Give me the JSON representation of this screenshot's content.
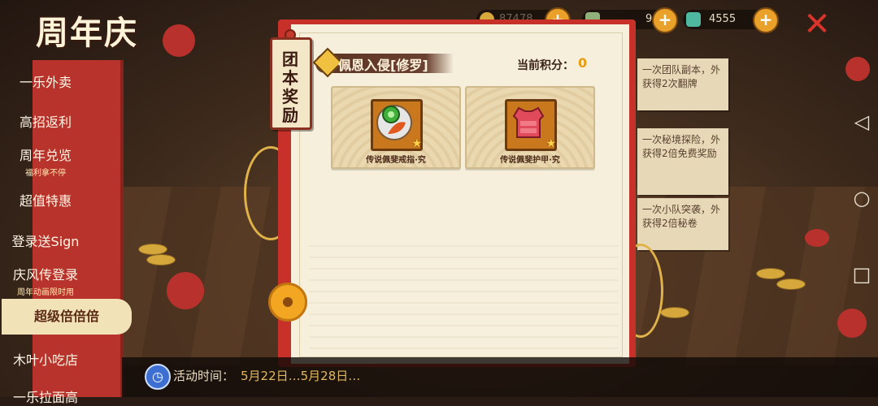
{
  "app": {
    "title": "周年庆"
  },
  "resources": [
    {
      "icon": "coin-icon",
      "value": "87478"
    },
    {
      "icon": "scroll-icon",
      "value": "9"
    },
    {
      "icon": "jade-icon",
      "value": "4555"
    }
  ],
  "sidebar": {
    "items": [
      {
        "label": "一乐外卖",
        "sub": ""
      },
      {
        "label": "高招返利",
        "sub": ""
      },
      {
        "label": "周年兑览",
        "sub": "福利拿不停"
      },
      {
        "label": "超值特惠",
        "sub": ""
      },
      {
        "label": "登录送Sign",
        "sub": ""
      },
      {
        "label": "庆风传登录",
        "sub": "周年动画限时用"
      },
      {
        "label": "超级倍倍倍",
        "sub": ""
      },
      {
        "label": "木叶小吃店",
        "sub": ""
      },
      {
        "label": "一乐拉面高",
        "sub": ""
      }
    ],
    "active_index": 6
  },
  "panel": {
    "tag": "团本奖励",
    "header_title": "佩恩入侵[修罗]",
    "score_label": "当前积分：",
    "score_value": "0",
    "rewards": [
      {
        "name": "传说佩斐戒指·究",
        "icon": "ring-icon"
      },
      {
        "name": "传说佩斐护甲·究",
        "icon": "armor-icon"
      }
    ]
  },
  "notices": [
    "一次团队副本，外获得2次翻牌",
    "一次秘境探险，外获得2倍免费奖励",
    "一次小队突袭，外获得2倍秘卷"
  ],
  "footer": {
    "time_label": "活动时间：",
    "time_value": "5月22日…5月28日…"
  },
  "colors": {
    "panel_red": "#c8302a",
    "paper": "#f6efdb",
    "score": "#e89c10",
    "menu_red": "#b8332b"
  }
}
